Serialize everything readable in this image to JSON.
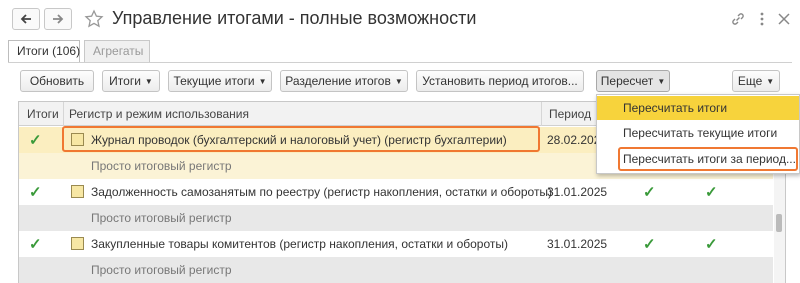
{
  "window": {
    "title": "Управление итогами - полные возможности",
    "back_icon": "arrow-left-icon",
    "forward_icon": "arrow-right-icon",
    "favorite_icon": "star-icon"
  },
  "tabs": [
    {
      "label": "Итоги (106)",
      "active": true
    },
    {
      "label": "Агрегаты",
      "active": false
    }
  ],
  "toolbar": {
    "refresh": "Обновить",
    "totals": "Итоги",
    "current_totals": "Текущие итоги",
    "split_totals": "Разделение итогов",
    "set_period": "Установить период итогов...",
    "recalc": "Пересчет",
    "more": "Еще"
  },
  "table": {
    "columns": [
      "Итоги",
      "Регистр и режим использования",
      "Период"
    ],
    "rows": [
      {
        "register": "Журнал проводок (бухгалтерский и налоговый учет) (регистр бухгалтерии)",
        "mode": "Просто итоговый регистр",
        "period": "28.02.202",
        "totals_on": true,
        "selected": true
      },
      {
        "register": "Задолженность самозанятым по реестру (регистр накопления, остатки и обороты)",
        "mode": "Просто итоговый регистр",
        "period": "31.01.2025",
        "totals_on": true,
        "selected": false
      },
      {
        "register": "Закупленные товары комитентов (регистр накопления, остатки и обороты)",
        "mode": "Просто итоговый регистр",
        "period": "31.01.2025",
        "totals_on": true,
        "selected": false
      }
    ]
  },
  "recalc_menu": {
    "items": [
      "Пересчитать итоги",
      "Пересчитать текущие итоги",
      "Пересчитать итоги за период..."
    ],
    "active_index": 0
  },
  "colors": {
    "highlight_border": "#f07832",
    "menu_active": "#f7d33c",
    "check": "#3a9a3a"
  }
}
